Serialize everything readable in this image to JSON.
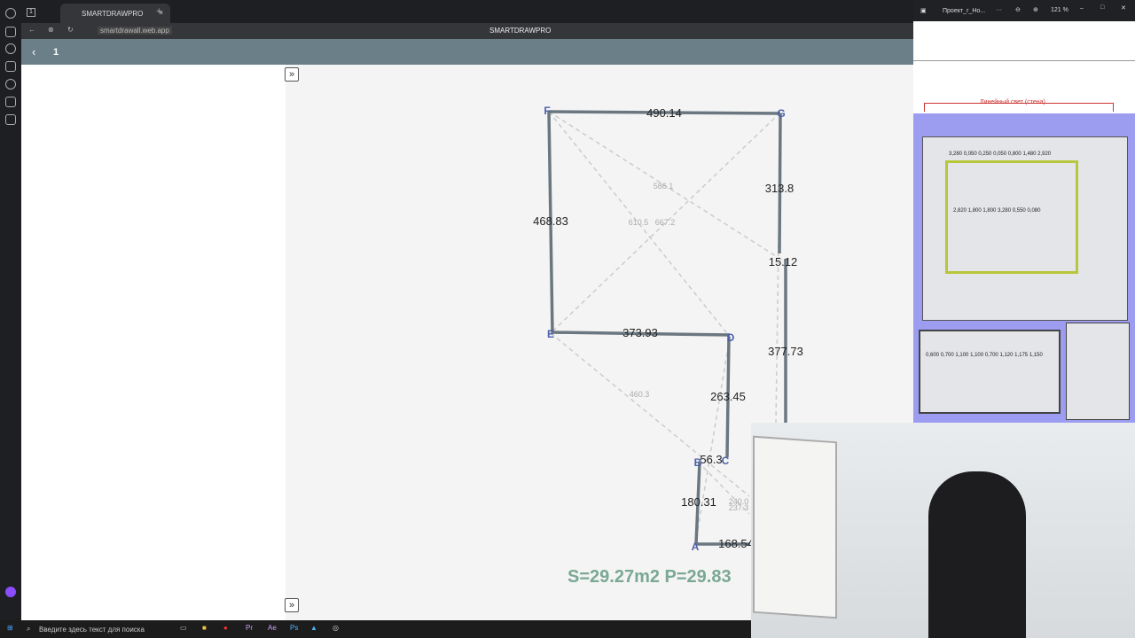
{
  "browser": {
    "tab_title": "SMARTDRAWPRO",
    "url": "smartdrawall.web.app",
    "page_title": "SMARTDRAWPRO",
    "workspace_count": "1"
  },
  "app": {
    "back": "‹",
    "page_number": "1",
    "expand": "»"
  },
  "drawing": {
    "vertices": [
      {
        "label": "F"
      },
      {
        "label": "G"
      },
      {
        "label": "E"
      },
      {
        "label": "D"
      },
      {
        "label": "C"
      },
      {
        "label": "B"
      },
      {
        "label": "A"
      }
    ],
    "walls": [
      "490.14",
      "313.8",
      "468.83",
      "15.12",
      "377.73",
      "373.93",
      "263.45",
      "56.3",
      "180.31",
      "168.54"
    ],
    "diagonals": [
      "586.1",
      "610.5",
      "667.2",
      "460.3",
      "240.0",
      "237.3"
    ],
    "summary": "S=29.27m2  P=29.83"
  },
  "pdf_viewer": {
    "title": "Проект_г_Но...",
    "more": "···",
    "zoom": "121 %",
    "heading": "Линейный свет (стена)",
    "dims": [
      "3,280",
      "0,050",
      "0,250",
      "0,050",
      "0,800",
      "1,480",
      "2,920",
      "2,820",
      "1,800",
      "1,800",
      "3,280",
      "0,550",
      "0,080",
      "0,600",
      "0,700",
      "1,100",
      "1,100",
      "0,700",
      "1,120",
      "1,175",
      "1,150"
    ]
  },
  "taskbar": {
    "search_placeholder": "Введите здесь текст для поиска"
  }
}
